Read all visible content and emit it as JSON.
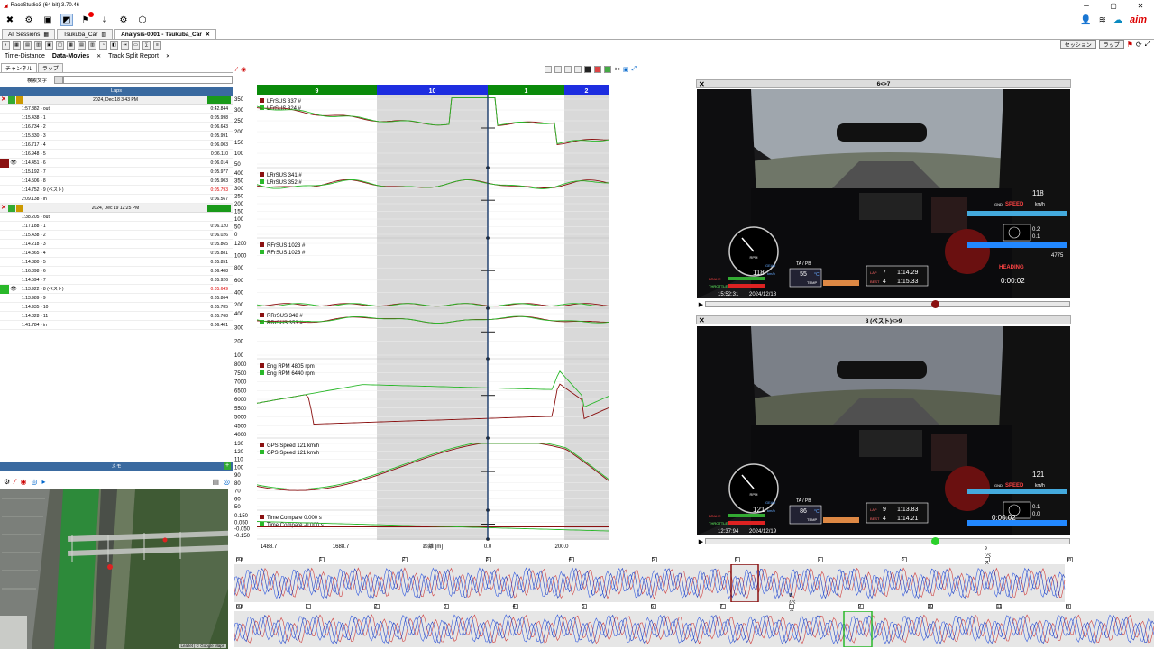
{
  "app": {
    "title": "RaceStudio3 (64 bit) 3.70.46"
  },
  "tabs": [
    {
      "label": "All Sessions"
    },
    {
      "label": "Tsukuba_Car"
    },
    {
      "label": "Analysis-0001 - Tsukuba_Car"
    }
  ],
  "right_buttons": {
    "session": "セッション",
    "lap": "ラップ"
  },
  "subtabs": [
    {
      "label": "Time-Distance"
    },
    {
      "label": "Data-Movies"
    },
    {
      "label": "Track Split Report"
    }
  ],
  "left_panel": {
    "tab_channel": "チャンネル",
    "tab_lap": "ラップ",
    "search_label": "検索文字",
    "search_value": "",
    "laps_header": "Laps",
    "memo_header": "メモ",
    "sessions": [
      {
        "date": "2024, Dec 18 3:43 PM",
        "laps": [
          {
            "name": "1:57.882 - out",
            "value": "0:42.844"
          },
          {
            "name": "1:15.438 - 1",
            "value": "0:05.998"
          },
          {
            "name": "1:16.734 - 2",
            "value": "0:06.643"
          },
          {
            "name": "1:15.330 - 3",
            "value": "0:05.991"
          },
          {
            "name": "1:16.717 - 4",
            "value": "0:06.003"
          },
          {
            "name": "1:16.948 - 5",
            "value": "0:06.110"
          },
          {
            "name": "1:14.451 - 6",
            "value": "0:06.014"
          },
          {
            "name": "1:15.192 - 7",
            "value": "0:05.977"
          },
          {
            "name": "1:14.506 - 8",
            "value": "0:05.903"
          },
          {
            "name": "1:14.752 - 9 (ベスト)",
            "value": "0:05.793"
          },
          {
            "name": "2:09.138 - in",
            "value": "0:06.567"
          }
        ]
      },
      {
        "date": "2024, Dec 19 12:25 PM",
        "laps": [
          {
            "name": "1:38.205 - out",
            "value": ""
          },
          {
            "name": "1:17.188 - 1",
            "value": "0:06.120"
          },
          {
            "name": "1:15.438 - 2",
            "value": "0:06.026"
          },
          {
            "name": "1:14.218 - 3",
            "value": "0:05.865"
          },
          {
            "name": "1:14.365 - 4",
            "value": "0:05.881"
          },
          {
            "name": "1:14.380 - 5",
            "value": "0:05.851"
          },
          {
            "name": "1:16.398 - 6",
            "value": "0:06.408"
          },
          {
            "name": "1:14.594 - 7",
            "value": "0:05.926"
          },
          {
            "name": "1:13.922 - 8 (ベスト)",
            "value": "0:05.649"
          },
          {
            "name": "1:13.989 - 9",
            "value": "0:05.864"
          },
          {
            "name": "1:14.935 - 10",
            "value": "0:05.785"
          },
          {
            "name": "1:14.828 - 11",
            "value": "0:05.768"
          },
          {
            "name": "1:41.784 - in",
            "value": "0:06.401"
          }
        ]
      }
    ],
    "map_attribution": "Leaflet | © Google Maps"
  },
  "chart": {
    "segments": [
      {
        "label": "9",
        "color": "#0a8a0a"
      },
      {
        "label": "10",
        "color": "#1e2ee0"
      },
      {
        "label": "1",
        "color": "#0a8a0a"
      },
      {
        "label": "2",
        "color": "#1e2ee0"
      }
    ],
    "panels": [
      {
        "ticks": [
          "350",
          "300",
          "250",
          "200",
          "150",
          "100",
          "50"
        ],
        "legend": [
          "LFrSUS  337 #",
          "LFrSUS  324 #"
        ]
      },
      {
        "ticks": [
          "400",
          "350",
          "300",
          "250",
          "200",
          "150",
          "100",
          "50",
          "0"
        ],
        "legend": [
          "LRrSUS  341 #",
          "LRrSUS  352 #"
        ]
      },
      {
        "ticks": [
          "1200",
          "1000",
          "800",
          "600",
          "400",
          "200"
        ],
        "legend": [
          "RFrSUS  1023 #",
          "RFrSUS  1023 #"
        ]
      },
      {
        "ticks": [
          "400",
          "300",
          "200",
          "100"
        ],
        "legend": [
          "RRrSUS  348 #",
          "RRrSUS  353 #"
        ]
      },
      {
        "ticks": [
          "8000",
          "7500",
          "7000",
          "6500",
          "6000",
          "5500",
          "5000",
          "4500",
          "4000"
        ],
        "legend": [
          "Eng RPM  4805 rpm",
          "Eng RPM  6440 rpm"
        ]
      },
      {
        "ticks": [
          "130",
          "120",
          "110",
          "100",
          "90",
          "80",
          "70",
          "60",
          "50"
        ],
        "legend": [
          "GPS Speed  121 km/h",
          "GPS Speed  121 km/h"
        ]
      },
      {
        "ticks": [
          "0.150",
          "0.050",
          "-0.050",
          "-0.150"
        ],
        "legend": [
          "Time Compare  0.000 s",
          "Time Compare  -0.000 s"
        ]
      }
    ],
    "x_ticks": [
      "1488.7",
      "1688.7",
      "0.0",
      "200.0"
    ],
    "x_label": "距離 [m]"
  },
  "videos": [
    {
      "title": "6<>7",
      "hud": {
        "speed": "118",
        "speed_unit": "km/h",
        "gnd": "GND",
        "speed_label": "SPEED",
        "temp": "55",
        "temp_unit": "°C",
        "lap": "7",
        "lap_time": "1:14.29",
        "best": "4",
        "best_time": "1:15.33",
        "clock": "15:52:31",
        "date": "2024/12/18",
        "delta": "0:00:02",
        "heading": "HEADING",
        "heading_val": "4775",
        "g1": "0.2",
        "g2": "0.1",
        "rpm_label": "RPM",
        "gear": "GEAR",
        "ta": "TA / PB",
        "temp_lbl": "TEMP",
        "lap_lbl": "LAP",
        "best_lbl": "BEST",
        "brake": "BRAKE",
        "throttle": "THROTTLE"
      },
      "knob_color": "#8a1010"
    },
    {
      "title": "8 (ベスト)<>9",
      "hud": {
        "speed": "121",
        "speed_unit": "km/h",
        "gnd": "GND",
        "speed_label": "SPEED",
        "temp": "86",
        "temp_unit": "°C",
        "lap": "9",
        "lap_time": "1:13.83",
        "best": "4",
        "best_time": "1:14.21",
        "clock": "12:37:94",
        "date": "2024/12/19",
        "delta": "0:00:02",
        "heading": "",
        "heading_val": "",
        "g1": "0.1",
        "g2": "0.0",
        "rpm_label": "RPM",
        "gear": "GEAR",
        "ta": "TA / PB",
        "temp_lbl": "TEMP",
        "lap_lbl": "LAP",
        "best_lbl": "BEST",
        "brake": "BRAKE",
        "throttle": "THROTTLE"
      },
      "knob_color": "#2ad02a"
    }
  ],
  "strips": [
    {
      "labels": [
        "out",
        "1",
        "2",
        "3",
        "4",
        "5",
        "6",
        "7",
        "8",
        "9 (ベスト)",
        "in"
      ]
    },
    {
      "labels": [
        "out",
        "1",
        "2",
        "3",
        "4",
        "5",
        "6",
        "7",
        "8 (ベスト)",
        "9",
        "10",
        "11",
        "in"
      ]
    }
  ]
}
